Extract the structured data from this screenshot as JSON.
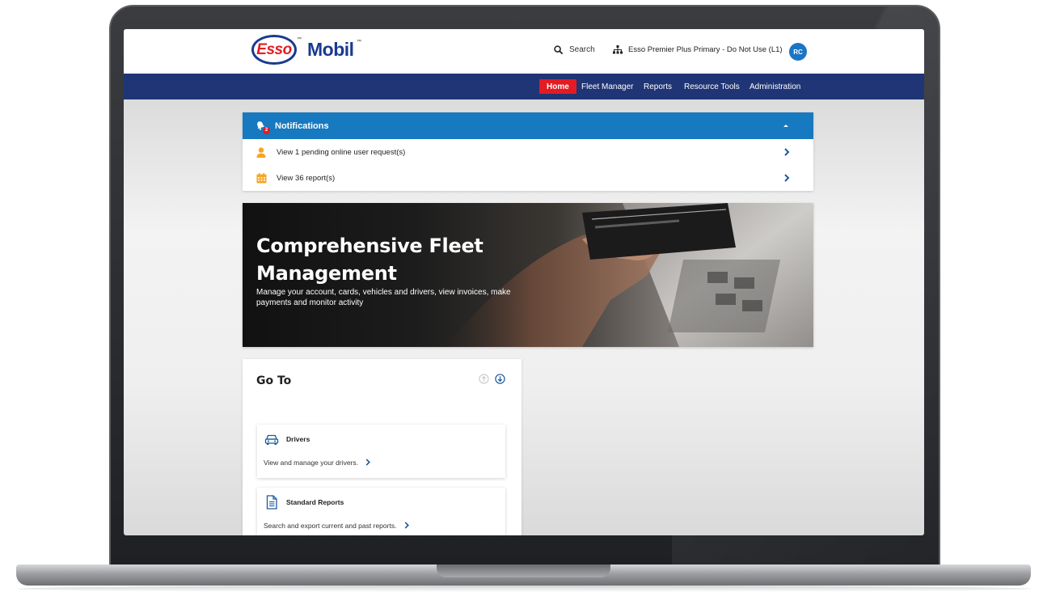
{
  "header": {
    "logo_primary": "Esso",
    "logo_secondary_pre": "Mob",
    "logo_secondary_post": "il",
    "trademark": "™",
    "search_label": "Search",
    "account_label": "Esso Premier Plus Primary - Do Not Use (L1)",
    "avatar_initials": "RC"
  },
  "nav": {
    "items": [
      {
        "label": "Home",
        "active": true
      },
      {
        "label": "Fleet Manager"
      },
      {
        "label": "Reports"
      },
      {
        "label": "Resource Tools"
      },
      {
        "label": "Administration"
      }
    ]
  },
  "notifications": {
    "title": "Notifications",
    "badge_count": "2",
    "items": [
      {
        "label": "View 1 pending online user request(s)",
        "icon": "user-icon"
      },
      {
        "label": "View 36 report(s)",
        "icon": "calendar-icon"
      }
    ]
  },
  "hero": {
    "title": "Comprehensive Fleet Management",
    "subtitle": "Manage your account, cards, vehicles and drivers, view invoices, make payments and monitor activity"
  },
  "goto": {
    "title": "Go To",
    "cards": [
      {
        "title": "Drivers",
        "description": "View and manage your drivers.",
        "icon": "car-icon"
      },
      {
        "title": "Standard Reports",
        "description": "Search and export current and past reports.",
        "icon": "document-icon"
      }
    ]
  },
  "colors": {
    "nav_bg": "#1f3575",
    "active_nav": "#e31c23",
    "notification_header": "#1779bf",
    "accent_blue": "#1c74c4",
    "brand_red": "#e31c23",
    "brand_blue": "#1a3a8f"
  }
}
